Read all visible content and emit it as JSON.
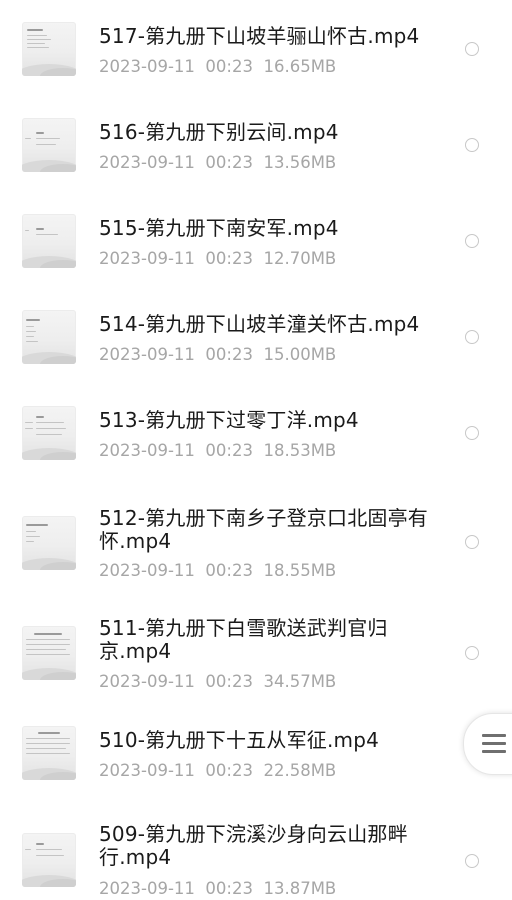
{
  "files": [
    {
      "name": "517-第九册下山坡羊骊山怀古.mp4",
      "date": "2023-09-11",
      "time": "00:23",
      "size": "16.65MB"
    },
    {
      "name": "516-第九册下别云间.mp4",
      "date": "2023-09-11",
      "time": "00:23",
      "size": "13.56MB"
    },
    {
      "name": "515-第九册下南安军.mp4",
      "date": "2023-09-11",
      "time": "00:23",
      "size": "12.70MB"
    },
    {
      "name": "514-第九册下山坡羊潼关怀古.mp4",
      "date": "2023-09-11",
      "time": "00:23",
      "size": "15.00MB"
    },
    {
      "name": "513-第九册下过零丁洋.mp4",
      "date": "2023-09-11",
      "time": "00:23",
      "size": "18.53MB"
    },
    {
      "name": "512-第九册下南乡子登京口北固亭有怀.mp4",
      "date": "2023-09-11",
      "time": "00:23",
      "size": "18.55MB"
    },
    {
      "name": "511-第九册下白雪歌送武判官归京.mp4",
      "date": "2023-09-11",
      "time": "00:23",
      "size": "34.57MB"
    },
    {
      "name": "510-第九册下十五从军征.mp4",
      "date": "2023-09-11",
      "time": "00:23",
      "size": "22.58MB"
    },
    {
      "name": "509-第九册下浣溪沙身向云山那畔行.mp4",
      "date": "2023-09-11",
      "time": "00:23",
      "size": "13.87MB"
    }
  ],
  "colors": {
    "name_text": "#1a1a1a",
    "meta_text": "#a6a6a6",
    "radio_border": "#c8c8c8",
    "background": "#ffffff"
  },
  "floating_menu": {
    "icon": "menu-icon"
  }
}
